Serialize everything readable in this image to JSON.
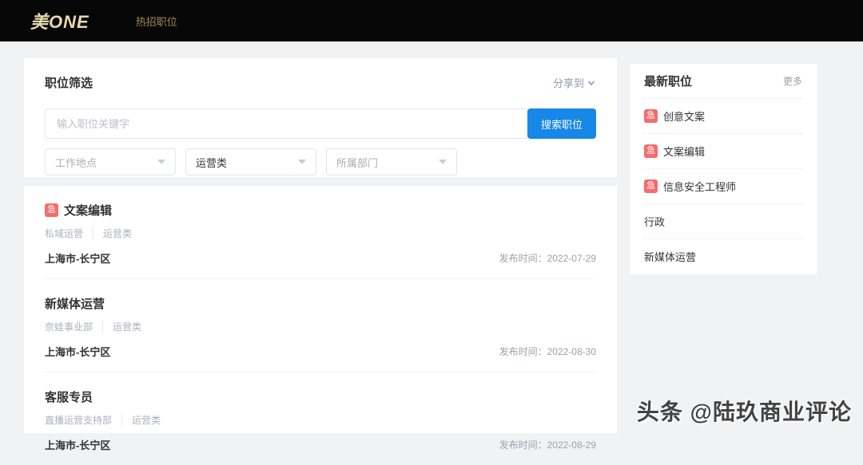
{
  "labels": {
    "urgent": "急",
    "posted": "发布时间："
  },
  "header": {
    "logo": "美ONE",
    "nav_hot_jobs": "热招职位"
  },
  "filter": {
    "title": "职位筛选",
    "share_label": "分享到",
    "search_placeholder": "输入职位关键字",
    "search_button": "搜索职位",
    "dropdowns": [
      {
        "label": "工作地点"
      },
      {
        "label": "运营类"
      },
      {
        "label": "所属部门"
      }
    ]
  },
  "jobs": {
    "items": [
      {
        "title": "文案编辑",
        "urgent": true,
        "tags": [
          "私域运营",
          "运营类"
        ],
        "location": "上海市-长宁区",
        "date": "2022-07-29"
      },
      {
        "title": "新媒体运营",
        "urgent": false,
        "tags": [
          "奈娃事业部",
          "运营类"
        ],
        "location": "上海市-长宁区",
        "date": "2022-08-30"
      },
      {
        "title": "客服专员",
        "urgent": false,
        "tags": [
          "直播运营支持部",
          "运营类"
        ],
        "location": "上海市-长宁区",
        "date": "2022-08-29"
      }
    ]
  },
  "sidebar": {
    "title": "最新职位",
    "more_label": "更多",
    "items": [
      {
        "label": "创意文案",
        "urgent": true
      },
      {
        "label": "文案编辑",
        "urgent": true
      },
      {
        "label": "信息安全工程师",
        "urgent": true
      },
      {
        "label": "行政",
        "urgent": false
      },
      {
        "label": "新媒体运营",
        "urgent": false
      }
    ]
  },
  "watermark": "头条 @陆玖商业评论",
  "colors": {
    "accent_blue": "#1787e8",
    "urgent_red": "#f56c6c",
    "logo_gold": "#e8d9ae",
    "nav_gold": "#a18a58",
    "header_bg": "#070707",
    "page_bg": "#f1f2f4"
  }
}
